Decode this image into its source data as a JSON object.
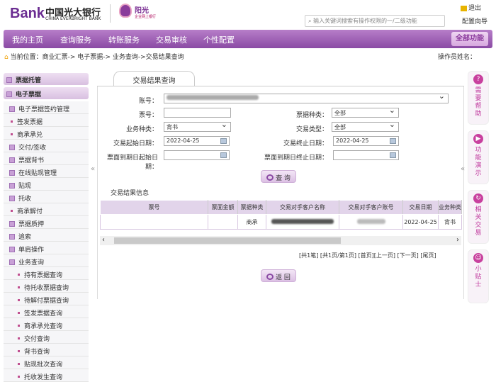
{
  "header": {
    "logo_text": "Bank",
    "bank_name_cn": "中国光大银行",
    "bank_name_en": "CHINA EVERBRIGHT BANK",
    "badge_title": "阳光",
    "badge_sub": "企业网上银行",
    "search_placeholder": "输入关键词搜索有操作权限的一/二级功能",
    "logout": "退出",
    "config_guide": "配置向导"
  },
  "nav": {
    "items": [
      "我的主页",
      "查询服务",
      "转账服务",
      "交易审核",
      "个性配置"
    ],
    "all_functions": "全部功能"
  },
  "breadcrumb": {
    "text": "当前位置：商业汇票-> 电子票据-> 业务查询->交易结果查询",
    "operator": "操作员姓名："
  },
  "sidebar": {
    "headers": [
      "票据托管",
      "电子票据"
    ],
    "items": [
      {
        "label": "电子票据签约管理",
        "type": "box"
      },
      {
        "label": "签发票据",
        "type": "dot"
      },
      {
        "label": "商承承兑",
        "type": "dot"
      },
      {
        "label": "交付/签收",
        "type": "box"
      },
      {
        "label": "票据背书",
        "type": "box"
      },
      {
        "label": "在线贴现管理",
        "type": "box"
      },
      {
        "label": "贴现",
        "type": "box"
      },
      {
        "label": "托收",
        "type": "box"
      },
      {
        "label": "商承解付",
        "type": "dot"
      },
      {
        "label": "票据质押",
        "type": "box"
      },
      {
        "label": "追索",
        "type": "box"
      },
      {
        "label": "单肩操作",
        "type": "box"
      },
      {
        "label": "业务查询",
        "type": "box"
      },
      {
        "label": "持有票据查询",
        "type": "sub"
      },
      {
        "label": "待托收票据查询",
        "type": "sub"
      },
      {
        "label": "待解付票据查询",
        "type": "sub"
      },
      {
        "label": "签发票据查询",
        "type": "sub"
      },
      {
        "label": "商承承兑查询",
        "type": "sub"
      },
      {
        "label": "交付查询",
        "type": "sub"
      },
      {
        "label": "背书查询",
        "type": "sub"
      },
      {
        "label": "贴现批次查询",
        "type": "sub"
      },
      {
        "label": "托收发生查询",
        "type": "sub"
      }
    ]
  },
  "form": {
    "tab": "交易结果查询",
    "account_label": "账号：",
    "bill_no_label": "票号：",
    "bill_no_value": "",
    "bill_type_label": "票据种类：",
    "bill_type_value": "全部",
    "biz_type_label": "业务种类：",
    "biz_type_value": "背书",
    "trade_type_label": "交易类型：",
    "trade_type_value": "全部",
    "start_date_label": "交易起始日期：",
    "start_date_value": "2022-04-25",
    "end_date_label": "交易终止日期：",
    "end_date_value": "2022-04-25",
    "due_start_label": "票面到期日起始日期：",
    "due_end_label": "票面到期日终止日期：",
    "query_button": "查 询"
  },
  "results": {
    "title": "交易结果信息",
    "columns": [
      "票号",
      "票面金额",
      "票据种类",
      "交易对手客户名称",
      "交易对手客户账号",
      "交易日期",
      "业务种类"
    ],
    "rows": [
      {
        "bill_no": "",
        "amount": "",
        "bill_type": "商承",
        "counterparty_name": "",
        "counterparty_account": "",
        "date": "2022-04-25",
        "biz_type": "背书"
      }
    ],
    "pager": "[共1笔] [共1页/第1页] [首页][上一页] [下一页] [尾页]",
    "back_button": "返 回"
  },
  "rail": [
    {
      "label": "需要帮助",
      "icon": "?"
    },
    {
      "label": "功能演示",
      "icon": "▶"
    },
    {
      "label": "相关交易",
      "icon": "↻"
    },
    {
      "label": "小贴士",
      "icon": "☺"
    }
  ],
  "colors": {
    "primary": "#8a4aa4",
    "accent": "#c03a9e"
  }
}
